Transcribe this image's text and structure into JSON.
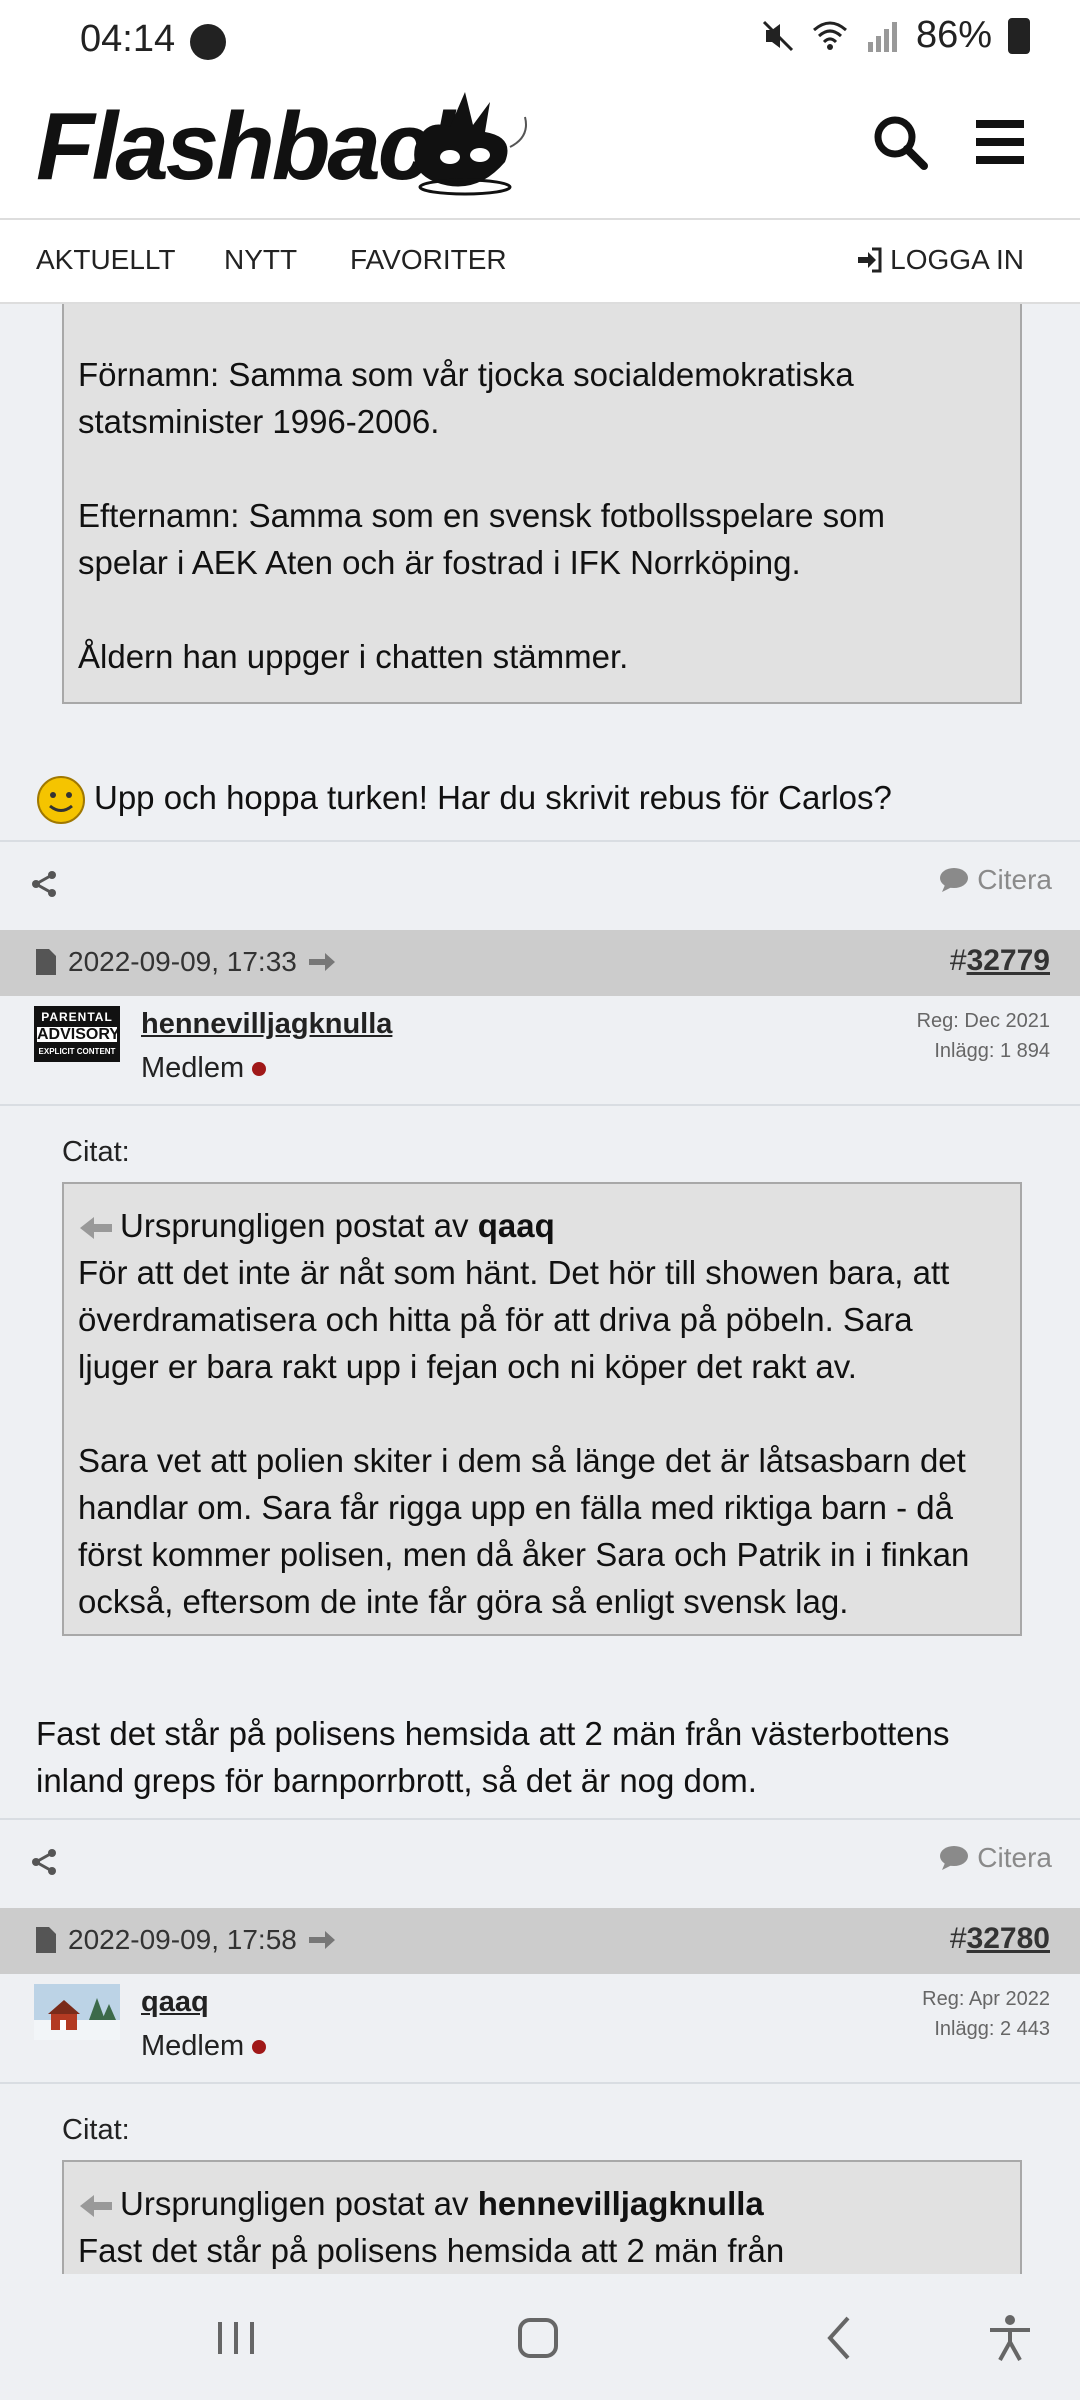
{
  "status": {
    "time": "04:14",
    "battery": "86%"
  },
  "header": {
    "logo_text": "Flashback",
    "icons": [
      "search-icon",
      "menu-icon"
    ]
  },
  "nav": {
    "items": [
      "AKTUELLT",
      "NYTT",
      "FAVORITER"
    ],
    "login_label": "LOGGA IN"
  },
  "post1": {
    "quote_lines": [
      "Förnamn: Samma som vår tjocka socialdemokratiska",
      "statsminister 1996-2006.",
      "",
      "Efternamn: Samma som en svensk fotbollsspelare som",
      "spelar i AEK Aten och är fostrad i IFK Norrköping.",
      "",
      "Åldern han uppger i chatten stämmer."
    ],
    "text": "Upp och hoppa turken! Har du skrivit rebus för Carlos?",
    "citera": "Citera"
  },
  "post2": {
    "date": "2022-09-09, 17:33",
    "number_prefix": "#",
    "number": "32779",
    "username": "hennevilljagknulla",
    "role": "Medlem",
    "reg": "Reg: Dec 2021",
    "posts": "Inlägg: 1 894",
    "citat_label": "Citat:",
    "quote_intro": "Ursprungligen postat av",
    "quote_user": "qaaq",
    "quote_lines": [
      "För att det inte är nåt som hänt. Det hör till showen bara, att",
      "överdramatisera och hitta på för att driva på pöbeln. Sara",
      "ljuger er bara rakt upp i fejan och ni köper det rakt av.",
      "",
      "Sara vet att polien skiter i dem så länge det är låtsasbarn det",
      "handlar om. Sara får rigga upp en fälla med riktiga barn - då",
      "först kommer polisen, men då åker Sara och Patrik in i finkan",
      "också, eftersom de inte får göra så enligt svensk lag."
    ],
    "text_lines": [
      "Fast det står på polisens hemsida att 2 män från västerbottens",
      "inland greps för barnporrbrott, så det är nog dom."
    ],
    "citera": "Citera"
  },
  "post3": {
    "date": "2022-09-09, 17:58",
    "number_prefix": "#",
    "number": "32780",
    "username": "qaaq",
    "role": "Medlem",
    "reg": "Reg: Apr 2022",
    "posts": "Inlägg: 2 443",
    "citat_label": "Citat:",
    "quote_intro": "Ursprungligen postat av",
    "quote_user": "hennevilljagknulla",
    "quote_first_line": "Fast det står på polisens hemsida att 2 män från"
  },
  "avatar1_text": [
    "PARENTAL",
    "ADVISORY",
    "EXPLICIT CONTENT"
  ]
}
